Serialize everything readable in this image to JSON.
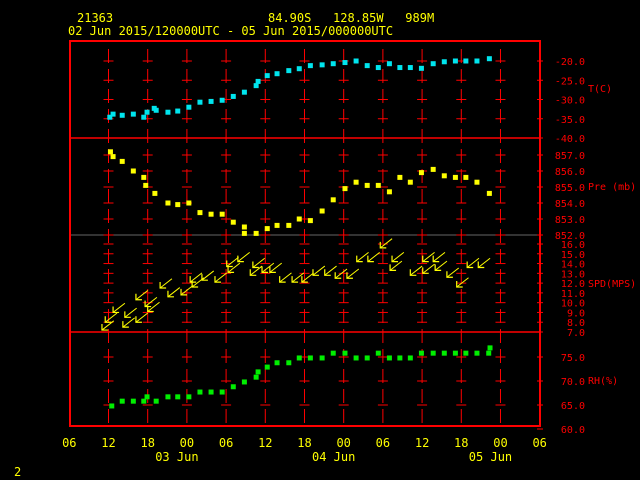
{
  "header": {
    "station": "21363",
    "location": "84.90S   128.85W   989M",
    "period": "02 Jun 2015/120000UTC - 05 Jun 2015/000000UTC"
  },
  "footer_label": "2",
  "colors": {
    "frame": "#ff0000",
    "text": "#ffff00",
    "temp": "#00e5ee",
    "pressure": "#ffff00",
    "wind": "#ffff00",
    "rh": "#00ee00"
  },
  "chart_data": [
    {
      "type": "scatter",
      "title": "Temperature",
      "ylabel": "T(C)",
      "ylim": [
        -40,
        -20
      ],
      "yticks": [
        "-20.0",
        "-25.0",
        "-30.0",
        "-35.0",
        "-40.0"
      ],
      "xunit": "hours since 02 Jun 12UTC",
      "points": [
        [
          0.2,
          -34.6
        ],
        [
          0.7,
          -33.8
        ],
        [
          2.1,
          -34.1
        ],
        [
          3.8,
          -33.8
        ],
        [
          5.4,
          -34.6
        ],
        [
          5.9,
          -33.3
        ],
        [
          7.0,
          -32.3
        ],
        [
          7.3,
          -32.8
        ],
        [
          9.1,
          -33.3
        ],
        [
          10.6,
          -33.0
        ],
        [
          12.3,
          -32.0
        ],
        [
          14.0,
          -30.7
        ],
        [
          15.7,
          -30.5
        ],
        [
          17.4,
          -30.2
        ],
        [
          19.1,
          -29.2
        ],
        [
          20.8,
          -28.1
        ],
        [
          22.6,
          -26.4
        ],
        [
          22.9,
          -25.3
        ],
        [
          24.3,
          -23.8
        ],
        [
          25.8,
          -23.3
        ],
        [
          27.6,
          -22.5
        ],
        [
          29.2,
          -22.0
        ],
        [
          30.9,
          -21.2
        ],
        [
          32.7,
          -21.0
        ],
        [
          34.4,
          -20.7
        ],
        [
          36.2,
          -20.4
        ],
        [
          37.9,
          -20.0
        ],
        [
          39.6,
          -21.2
        ],
        [
          41.3,
          -21.7
        ],
        [
          43.0,
          -20.7
        ],
        [
          44.6,
          -21.7
        ],
        [
          46.2,
          -21.7
        ],
        [
          47.9,
          -21.9
        ],
        [
          49.7,
          -20.7
        ],
        [
          51.4,
          -20.2
        ],
        [
          53.1,
          -20.0
        ],
        [
          54.7,
          -20.0
        ],
        [
          56.4,
          -20.0
        ],
        [
          58.3,
          -19.4
        ]
      ]
    },
    {
      "type": "scatter",
      "title": "Pressure",
      "ylabel": "Pre (mb)",
      "ylim": [
        852,
        857
      ],
      "yticks": [
        "857.0",
        "856.0",
        "855.0",
        "854.0",
        "853.0",
        "852.0"
      ],
      "points": [
        [
          0.3,
          857.2
        ],
        [
          0.7,
          856.9
        ],
        [
          2.1,
          856.6
        ],
        [
          3.8,
          856.0
        ],
        [
          5.4,
          855.6
        ],
        [
          5.7,
          855.1
        ],
        [
          7.1,
          854.6
        ],
        [
          9.1,
          854.0
        ],
        [
          10.6,
          853.9
        ],
        [
          12.3,
          854.0
        ],
        [
          14.0,
          853.4
        ],
        [
          15.7,
          853.3
        ],
        [
          17.4,
          853.3
        ],
        [
          19.1,
          852.8
        ],
        [
          20.8,
          852.5
        ],
        [
          20.8,
          852.1
        ],
        [
          22.6,
          852.1
        ],
        [
          24.3,
          852.4
        ],
        [
          25.8,
          852.6
        ],
        [
          27.6,
          852.6
        ],
        [
          29.2,
          853.0
        ],
        [
          30.9,
          852.9
        ],
        [
          32.7,
          853.5
        ],
        [
          34.4,
          854.2
        ],
        [
          36.2,
          854.9
        ],
        [
          37.9,
          855.3
        ],
        [
          39.6,
          855.1
        ],
        [
          41.3,
          855.1
        ],
        [
          43.0,
          854.7
        ],
        [
          44.6,
          855.6
        ],
        [
          46.2,
          855.3
        ],
        [
          47.9,
          855.9
        ],
        [
          49.7,
          856.1
        ],
        [
          51.4,
          855.7
        ],
        [
          53.1,
          855.6
        ],
        [
          54.7,
          855.6
        ],
        [
          56.4,
          855.3
        ],
        [
          58.3,
          854.6
        ]
      ]
    },
    {
      "type": "wind-vector",
      "title": "Wind speed and direction",
      "ylabel": "SPD(MPS)",
      "ylim": [
        7,
        16
      ],
      "yticks": [
        "16.0",
        "15.0",
        "14.0",
        "13.0",
        "12.0",
        "11.0",
        "10.0",
        "9.0",
        "8.0",
        "7.0"
      ],
      "direction_deg": 50,
      "points": [
        [
          -1.0,
          7.2
        ],
        [
          -0.5,
          8.0
        ],
        [
          0.7,
          9.0
        ],
        [
          2.2,
          7.5
        ],
        [
          2.5,
          8.5
        ],
        [
          4.2,
          10.3
        ],
        [
          4.2,
          8.0
        ],
        [
          5.6,
          9.6
        ],
        [
          6.0,
          9.1
        ],
        [
          7.9,
          11.5
        ],
        [
          9.1,
          10.6
        ],
        [
          11.1,
          10.8
        ],
        [
          12.5,
          12.1
        ],
        [
          12.8,
          11.6
        ],
        [
          14.3,
          12.3
        ],
        [
          16.3,
          12.1
        ],
        [
          18.1,
          13.7
        ],
        [
          18.3,
          13.1
        ],
        [
          19.8,
          14.2
        ],
        [
          21.7,
          12.8
        ],
        [
          22.1,
          13.6
        ],
        [
          23.5,
          13.1
        ],
        [
          24.7,
          13.1
        ],
        [
          26.2,
          12.1
        ],
        [
          28.1,
          12.1
        ],
        [
          29.6,
          12.1
        ],
        [
          31.3,
          12.8
        ],
        [
          33.1,
          12.8
        ],
        [
          34.7,
          12.5
        ],
        [
          36.5,
          12.5
        ],
        [
          38.0,
          14.2
        ],
        [
          39.7,
          14.2
        ],
        [
          41.6,
          15.6
        ],
        [
          43.1,
          13.3
        ],
        [
          43.4,
          14.2
        ],
        [
          46.2,
          12.8
        ],
        [
          48.1,
          14.2
        ],
        [
          48.1,
          13.0
        ],
        [
          49.7,
          14.2
        ],
        [
          50.0,
          13.3
        ],
        [
          51.8,
          12.6
        ],
        [
          53.3,
          11.6
        ],
        [
          54.9,
          13.6
        ],
        [
          56.6,
          13.6
        ]
      ]
    },
    {
      "type": "scatter",
      "title": "Relative humidity",
      "ylabel": "RH(%)",
      "ylim": [
        60,
        75
      ],
      "yticks": [
        "75.0",
        "70.0",
        "65.0",
        "60.0"
      ],
      "points": [
        [
          0.5,
          64.8
        ],
        [
          2.1,
          65.8
        ],
        [
          3.8,
          65.8
        ],
        [
          5.4,
          65.8
        ],
        [
          5.9,
          66.7
        ],
        [
          7.3,
          65.8
        ],
        [
          9.1,
          66.7
        ],
        [
          10.6,
          66.7
        ],
        [
          12.3,
          66.7
        ],
        [
          14.0,
          67.7
        ],
        [
          15.7,
          67.7
        ],
        [
          17.4,
          67.7
        ],
        [
          19.1,
          68.8
        ],
        [
          20.8,
          69.8
        ],
        [
          22.6,
          70.8
        ],
        [
          22.9,
          71.9
        ],
        [
          24.3,
          72.9
        ],
        [
          25.8,
          73.8
        ],
        [
          27.6,
          73.8
        ],
        [
          29.2,
          74.8
        ],
        [
          30.9,
          74.8
        ],
        [
          32.7,
          74.8
        ],
        [
          34.4,
          75.8
        ],
        [
          36.2,
          75.8
        ],
        [
          37.9,
          74.8
        ],
        [
          39.6,
          74.8
        ],
        [
          41.3,
          75.8
        ],
        [
          43.0,
          74.8
        ],
        [
          44.6,
          74.8
        ],
        [
          46.2,
          74.8
        ],
        [
          47.9,
          75.8
        ],
        [
          49.7,
          75.8
        ],
        [
          51.4,
          75.8
        ],
        [
          53.1,
          75.8
        ],
        [
          54.7,
          75.8
        ],
        [
          56.4,
          75.8
        ],
        [
          58.2,
          75.8
        ],
        [
          58.4,
          76.9
        ]
      ]
    }
  ],
  "x_axis": {
    "ticks": [
      "06",
      "12",
      "18",
      "00",
      "06",
      "12",
      "18",
      "00",
      "06",
      "12",
      "18",
      "00",
      "06"
    ],
    "tick_hours": [
      -6,
      0,
      6,
      12,
      18,
      24,
      30,
      36,
      42,
      48,
      54,
      60,
      66
    ],
    "dates": [
      {
        "label": "03 Jun",
        "hour": 12
      },
      {
        "label": "04 Jun",
        "hour": 36
      },
      {
        "label": "05 Jun",
        "hour": 60
      }
    ]
  }
}
